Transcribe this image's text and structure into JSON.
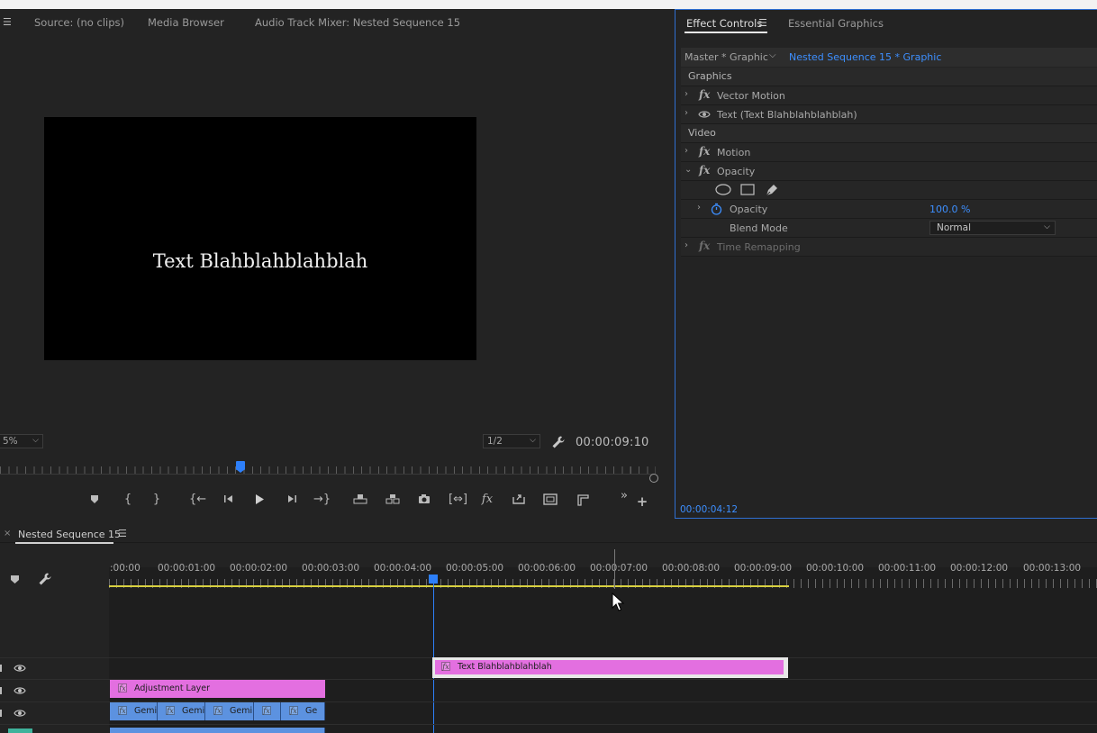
{
  "program_monitor": {
    "tabs": [
      "Source: (no clips)",
      "Media Browser",
      "Audio Track Mixer: Nested Sequence 15"
    ],
    "frame_text": "Text Blahblahblahblah",
    "zoom": "5%",
    "resolution": "1/2",
    "timecode": "00:00:09:10",
    "playhead_fraction": 0.36
  },
  "effect_controls": {
    "tabs": [
      "Effect Controls",
      "Essential Graphics"
    ],
    "master_label": "Master * Graphic",
    "clip_label": "Nested Sequence 15 * Graphic",
    "sections": {
      "graphics": "Graphics",
      "video": "Video"
    },
    "effects": {
      "vector_motion": "Vector Motion",
      "text": "Text (Text Blahblahblahblah)",
      "motion": "Motion",
      "opacity": "Opacity",
      "opacity_param": "Opacity",
      "opacity_value": "100.0 %",
      "blend_mode_label": "Blend Mode",
      "blend_mode_value": "Normal",
      "time_remapping": "Time Remapping"
    },
    "timecode": "00:00:04:12"
  },
  "timeline": {
    "sequence_name": "Nested Sequence 15",
    "ruler_labels": [
      ":00:00",
      "00:00:01:00",
      "00:00:02:00",
      "00:00:03:00",
      "00:00:04:00",
      "00:00:05:00",
      "00:00:06:00",
      "00:00:07:00",
      "00:00:08:00",
      "00:00:09:00",
      "00:00:10:00",
      "00:00:11:00",
      "00:00:12:00",
      "00:00:13:00"
    ],
    "clips": {
      "text_clip": "Text Blahblahblahblah",
      "adjustment_layer": "Adjustment Layer",
      "gemi1": "Gemi",
      "gemi2": "Gemi",
      "gemi3": "Gemi",
      "ge": "Ge"
    },
    "colors": {
      "playhead": "#2d7ff9",
      "graphic_clip": "#e36fe0",
      "video_clip": "#5c92e0",
      "work_area": "#d8d040"
    }
  }
}
